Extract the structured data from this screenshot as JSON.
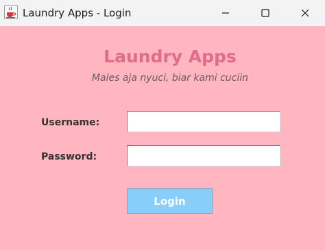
{
  "window": {
    "title": "Laundry Apps - Login",
    "icon": "java-coffee-cup-icon"
  },
  "header": {
    "title": "Laundry Apps",
    "tagline": "Males aja nyuci, biar kami cuciin"
  },
  "form": {
    "username_label": "Username:",
    "username_value": "",
    "password_label": "Password:",
    "password_value": "",
    "login_label": "Login"
  },
  "colors": {
    "background": "#ffb6c1",
    "heading": "#e06b8b",
    "button": "#87cefa",
    "button_text": "#ffffff",
    "titlebar": "#f3f3f3"
  }
}
